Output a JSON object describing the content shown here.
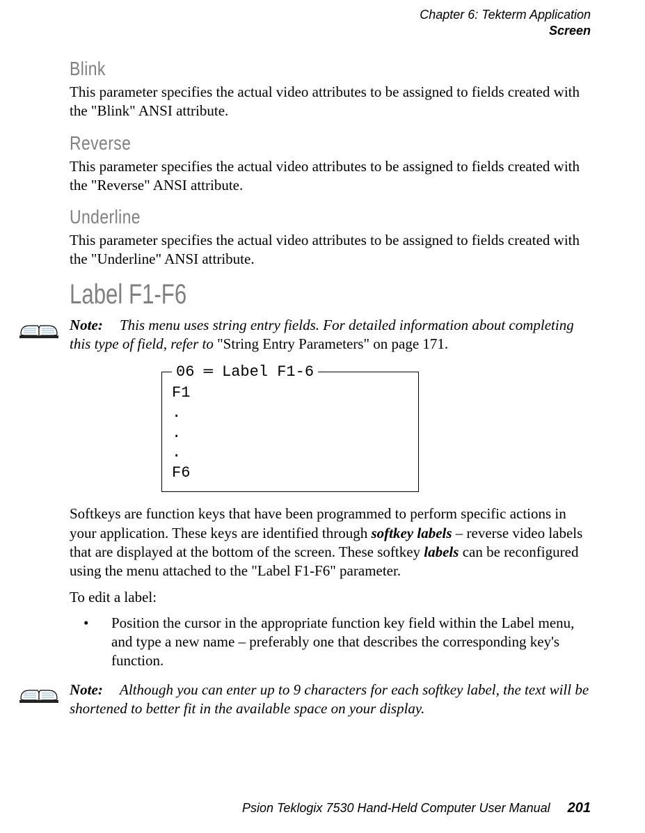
{
  "header": {
    "chapter_line": "Chapter  6:   Tekterm Application",
    "section_line": "Screen"
  },
  "blink": {
    "heading": "Blink",
    "para": "This parameter specifies the actual video attributes to be assigned to fields created with the \"Blink\" ANSI attribute."
  },
  "reverse": {
    "heading": "Reverse",
    "para": "This parameter specifies the actual video attributes to be assigned to fields created with the \"Reverse\" ANSI attribute."
  },
  "underline": {
    "heading": "Underline",
    "para": "This parameter specifies the actual video attributes to be assigned to fields created with the \"Underline\" ANSI attribute."
  },
  "label_section": {
    "heading": "Label F1-F6"
  },
  "note1": {
    "label": "Note:",
    "italic_part": "This menu uses string entry fields. For detailed information about completing this type of field, refer to ",
    "upright_part": "\"String Entry Parameters\" on page 171."
  },
  "menu_box": {
    "legend": " 06 ═ Label F1-6 ",
    "lines": [
      "F1",
      " .",
      " .",
      " .",
      "F6"
    ]
  },
  "softkeys_para_parts": {
    "p1": "Softkeys are function keys that have been programmed to perform specific actions in your application. These keys are identified through ",
    "em1": "softkey labels",
    "p2": " – reverse video labels that are displayed at the bottom of the screen. These softkey ",
    "em2": "labels",
    "p3": " can be reconfigured using the menu attached to the \"Label F1-F6\" parameter."
  },
  "edit_intro": "To edit a label:",
  "bullet1": "Position the cursor in the appropriate function key field within the Label menu, and type a new name – preferably one that describes the corresponding key's function.",
  "note2": {
    "label": "Note:",
    "text": "Although you can enter up to 9 characters for each softkey label, the text will be shortened to better fit in the available space on your display."
  },
  "footer": {
    "title": "Psion Teklogix 7530 Hand-Held Computer User Manual",
    "page": "201"
  }
}
